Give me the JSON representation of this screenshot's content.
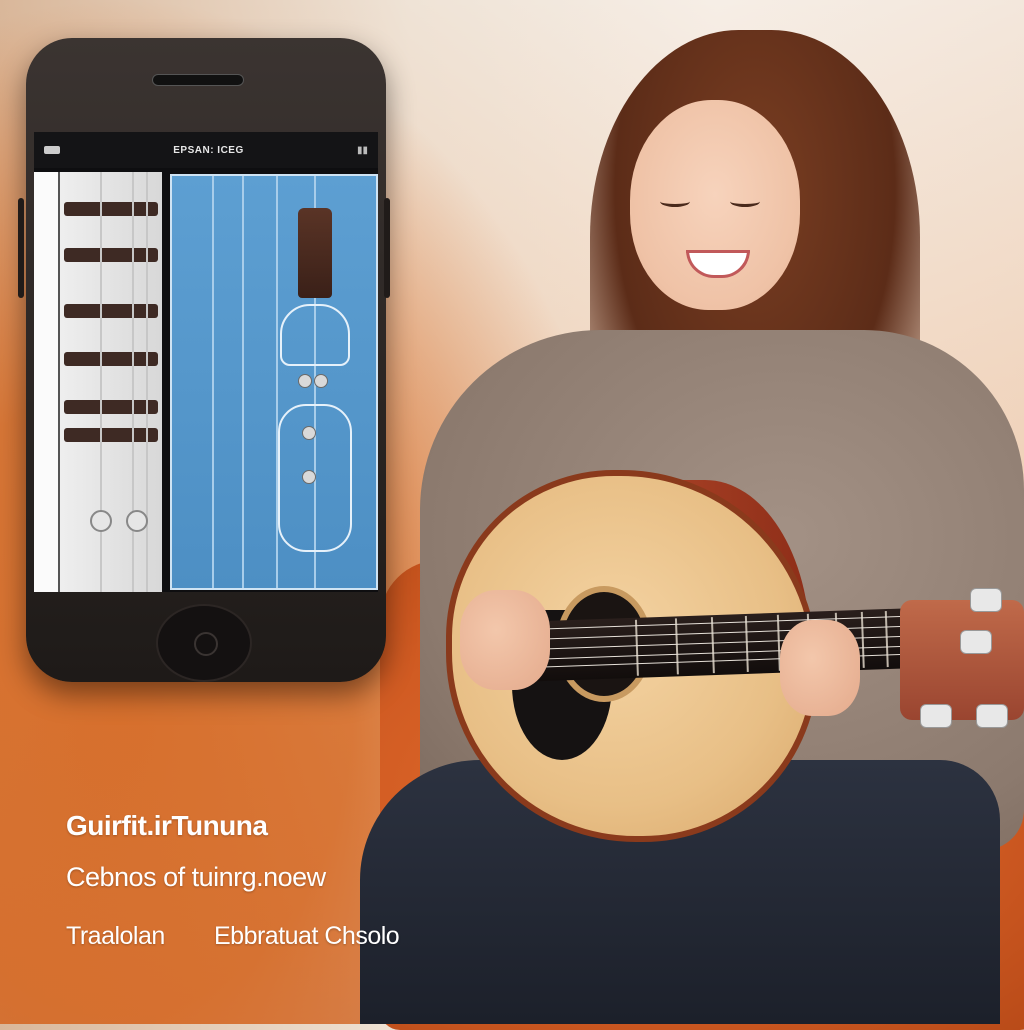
{
  "app": {
    "screen_title": "EPSAN: ICEG",
    "title": "Guirfit.irTununa",
    "subtitle": "Cebnos of tuinrg.noew",
    "option_left": "Traalolan",
    "option_right": "Ebbratuat Chsolo"
  },
  "icons": {
    "status_left": "battery-icon",
    "status_right": "signal-icon",
    "home": "home-button-icon",
    "headstock": "guitar-headstock-icon"
  },
  "colors": {
    "accent_orange": "#d66c28",
    "screen_blue": "#5d9fd2",
    "text": "#ffffff"
  }
}
